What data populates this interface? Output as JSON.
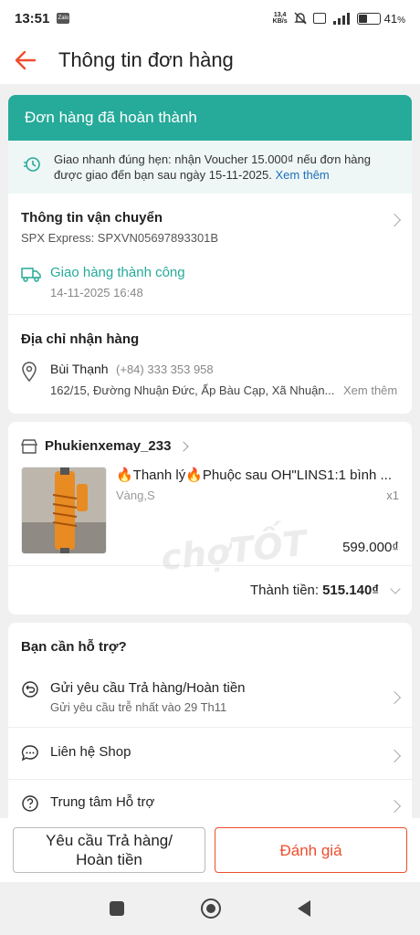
{
  "status_bar": {
    "time": "13:51",
    "net_speed_value": "13,4",
    "net_speed_unit": "KB/s",
    "battery": "41",
    "battery_unit": "%",
    "battery_level": 0.41
  },
  "header": {
    "title": "Thông tin đơn hàng"
  },
  "banner": {
    "text": "Đơn hàng đã hoàn thành"
  },
  "voucher": {
    "text": "Giao nhanh đúng hẹn: nhận Voucher 15.000₫ nếu đơn hàng được giao đến bạn sau ngày 15-11-2025.",
    "link": "Xem thêm"
  },
  "shipping": {
    "title": "Thông tin vận chuyển",
    "carrier": "SPX Express: SPXVN05697893301B",
    "status": "Giao hàng thành công",
    "time": "14-11-2025 16:48"
  },
  "address": {
    "title": "Địa chỉ nhận hàng",
    "name": "Bùi Thạnh",
    "phone": "(+84) 333 353 958",
    "line": "162/15, Đường Nhuận Đức, Ấp Bàu Cạp, Xã Nhuận...",
    "more": "Xem thêm"
  },
  "shop": {
    "name": "Phukienxemay_233",
    "product": {
      "name": "🔥Thanh lý🔥Phuộc sau OH\"LINS1:1 bình ...",
      "variant": "Vàng,S",
      "qty": "x1",
      "price": "599.000₫"
    },
    "total_label": "Thành tiền:",
    "total_value": "515.140₫"
  },
  "help": {
    "title": "Bạn cần hỗ trợ?",
    "items": [
      {
        "label": "Gửi yêu cầu Trả hàng/Hoàn tiền",
        "sub": "Gửi yêu cầu trễ nhất vào 29 Th11"
      },
      {
        "label": "Liên hệ Shop"
      },
      {
        "label": "Trung tâm Hỗ trợ"
      }
    ]
  },
  "actions": {
    "return_line1": "Yêu cầu Trả hàng/",
    "return_line2": "Hoàn tiền",
    "rate": "Đánh giá"
  },
  "watermark": "chợTỐT",
  "colors": {
    "accent": "#ee4d2d",
    "success": "#26aa99",
    "link": "#1e6fb8"
  }
}
